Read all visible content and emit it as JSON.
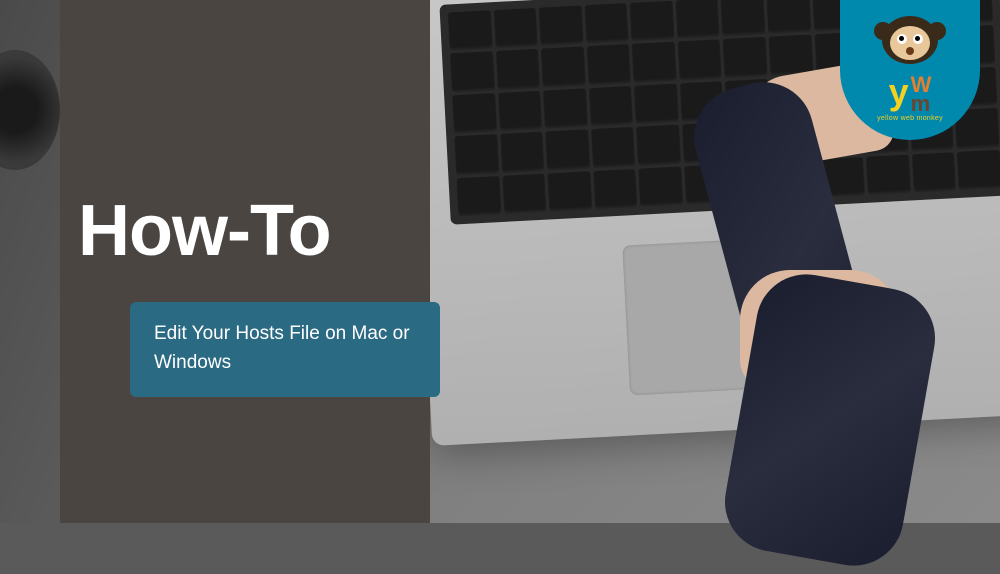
{
  "heading": "How-To",
  "subtitle": "Edit Your Hosts File on Mac or Windows",
  "logo": {
    "letter_y": "y",
    "letter_w": "W",
    "letter_m": "m",
    "tagline": "yellow web monkey",
    "colors": {
      "badge_bg": "#0088ad",
      "y_color": "#f5d020",
      "w_color": "#e08030",
      "m_color": "#6a4530"
    }
  },
  "colors": {
    "panel_bg": "#4a4541",
    "subtitle_bg": "#2b6a83",
    "text_white": "#ffffff"
  }
}
